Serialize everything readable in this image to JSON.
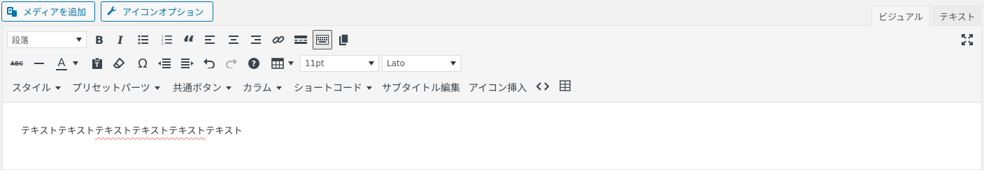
{
  "media_buttons": {
    "add_media": "メディアを追加",
    "icon_options": "アイコンオプション"
  },
  "tabs": {
    "visual": "ビジュアル",
    "text": "テキスト"
  },
  "toolbar": {
    "format_select": "段落",
    "font_size_select": "11pt",
    "font_family_select": "Lato",
    "icons_row1": [
      "bold-icon",
      "italic-icon",
      "bullet-list-icon",
      "numbered-list-icon",
      "blockquote-icon",
      "align-left-icon",
      "align-center-icon",
      "align-right-icon",
      "link-icon",
      "read-more-icon",
      "toolbar-toggle-icon",
      "copy-icon",
      "fullscreen-icon"
    ],
    "icons_row2": [
      "strikethrough-icon",
      "horizontal-line-icon",
      "text-color-icon",
      "paste-text-icon",
      "clear-formatting-icon",
      "special-char-icon",
      "outdent-icon",
      "indent-icon",
      "undo-icon",
      "redo-icon",
      "help-icon",
      "table-icon"
    ],
    "text_color_letter": "A",
    "strike_label": "ABC",
    "omega_label": "Ω",
    "bold_label": "B",
    "italic_label": "I",
    "quote_label": "“",
    "help_label": "?",
    "menus": {
      "style": "スタイル",
      "preset_parts": "プリセットパーツ",
      "common_buttons": "共通ボタン",
      "columns": "カラム",
      "shortcodes": "ショートコード",
      "subtitle_edit": "サブタイトル編集",
      "icon_insert": "アイコン挿入"
    }
  },
  "content": {
    "text_before": "テキストテキスト",
    "text_marked": "テキストテキストテキスト",
    "text_after": "テキスト"
  },
  "colors": {
    "accent": "#0073aa",
    "spellcheck": "#f0a0a0"
  }
}
